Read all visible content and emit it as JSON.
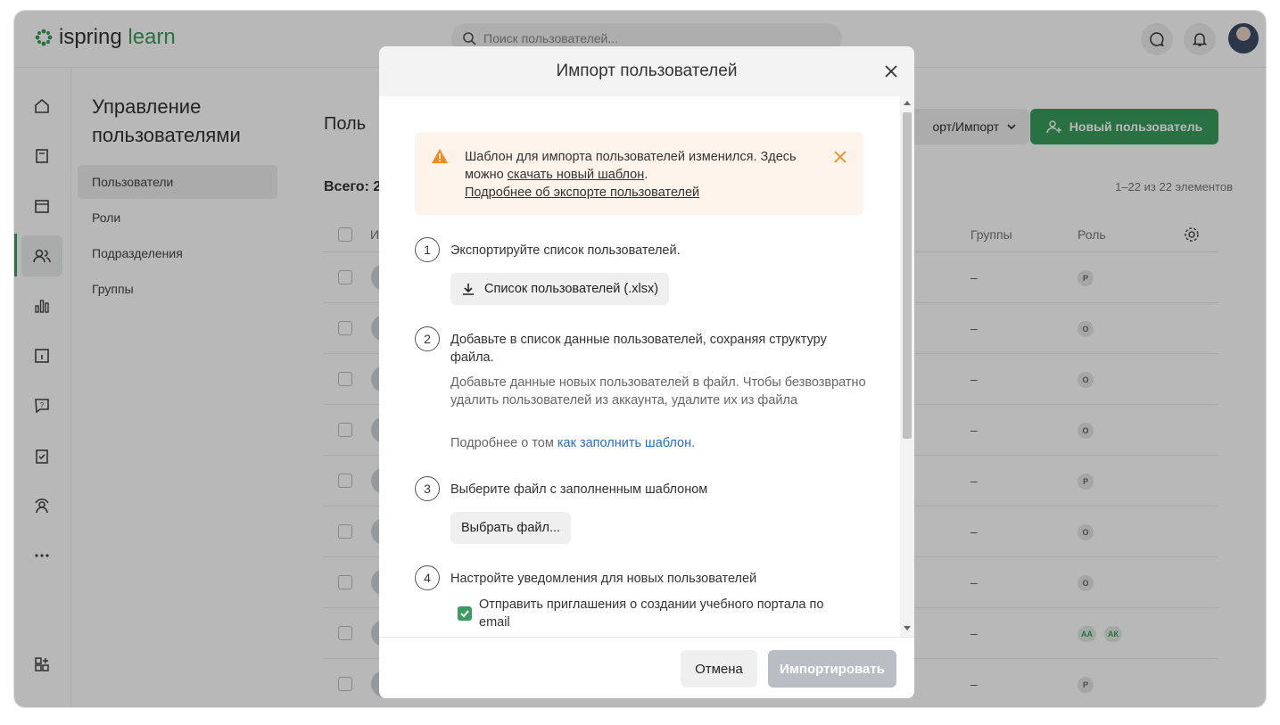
{
  "app": {
    "logo_part1": "ispring",
    "logo_part2": "learn",
    "search_placeholder": "Поиск пользователей..."
  },
  "subnav": {
    "title": "Управление пользователями",
    "items": [
      {
        "label": "Пользователи",
        "active": true
      },
      {
        "label": "Роли"
      },
      {
        "label": "Подразделения"
      },
      {
        "label": "Группы"
      }
    ]
  },
  "main": {
    "title": "Поль",
    "total": "Всего: 2",
    "range": "1–22 из 22 элементов",
    "export_label": "орт/Импорт",
    "new_user_label": "Новый пользователь",
    "columns": {
      "name": "И",
      "groups": "Группы",
      "role": "Роль"
    },
    "rows": [
      {
        "group": "–",
        "roles": [
          "Р"
        ]
      },
      {
        "group": "–",
        "roles": [
          "О"
        ]
      },
      {
        "group": "–",
        "roles": [
          "О"
        ]
      },
      {
        "group": "–",
        "roles": [
          "О"
        ]
      },
      {
        "group": "–",
        "roles": [
          "Р"
        ]
      },
      {
        "group": "–",
        "roles": [
          "О"
        ]
      },
      {
        "group": "–",
        "roles": [
          "О"
        ]
      },
      {
        "group": "–",
        "roles": [
          "АА",
          "АК"
        ]
      },
      {
        "group": "–",
        "roles": [
          "Р"
        ]
      }
    ]
  },
  "modal": {
    "title": "Импорт пользователей",
    "warning": {
      "text1": "Шаблон для импорта пользователей изменился. Здесь можно ",
      "link1": "скачать новый шаблон",
      "text2": ".",
      "link2": "Подробнее об экспорте пользователей"
    },
    "steps": [
      {
        "num": "1",
        "text": "Экспортируйте список пользователей.",
        "button": "Список пользователей (.xlsx)"
      },
      {
        "num": "2",
        "text": "Добавьте в список данные пользователей, сохраняя структуру файла.",
        "desc": "Добавьте данные новых пользователей в файл. Чтобы безвозвратно удалить пользователей из аккаунта, удалите их из файла",
        "more_prefix": "Подробнее о том ",
        "more_link": "как заполнить шаблон",
        "more_suffix": "."
      },
      {
        "num": "3",
        "text": "Выберите файл с заполненным шаблоном",
        "button": "Выбрать файл..."
      },
      {
        "num": "4",
        "text": "Настройте уведомления для новых пользователей",
        "checkbox": "Отправить приглашения о создании учебного портала по email",
        "checked": true
      }
    ],
    "cancel": "Отмена",
    "import": "Импортировать"
  },
  "colors": {
    "brand": "#3a9c5e",
    "warning": "#f08c1e",
    "link": "#2a6acb"
  }
}
